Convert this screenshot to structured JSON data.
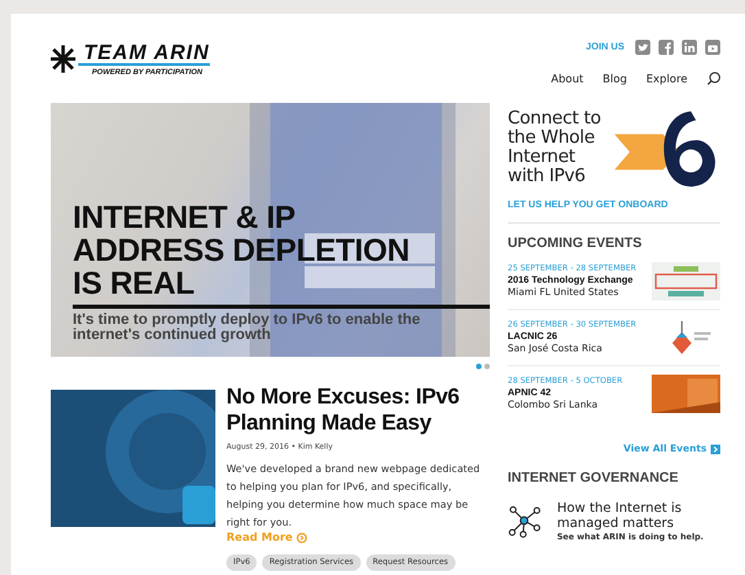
{
  "logo": {
    "name": "TEAM ARIN",
    "tagline": "POWERED BY PARTICIPATION"
  },
  "social": {
    "label": "JOIN US"
  },
  "nav": [
    {
      "label": "About"
    },
    {
      "label": "Blog"
    },
    {
      "label": "Explore"
    }
  ],
  "hero": {
    "headline": "INTERNET & IP ADDRESS DEPLETION IS REAL",
    "subtitle": "It's time to promptly deploy to IPv6 to enable the internet's continued growth",
    "slides": [
      {
        "selected": true
      },
      {
        "selected": false
      }
    ]
  },
  "post": {
    "title": "No More Excuses: IPv6 Planning Made Easy",
    "meta": "August 29, 2016 • Kim Kelly",
    "body": "We've developed a brand new webpage dedicated to helping you plan for IPv6, and specifically, helping you determine how much space may be right for you.",
    "read_more": "Read More",
    "tags": [
      "IPv6",
      "Registration Services",
      "Request Resources"
    ]
  },
  "promo": {
    "text": "Connect to the Whole Internet with IPv6",
    "link": "LET US HELP YOU GET ONBOARD"
  },
  "events": {
    "heading": "UPCOMING EVENTS",
    "items": [
      {
        "dates": "25 SEPTEMBER - 28 SEPTEMBER",
        "name": "2016 Technology Exchange",
        "place": "Miami FL United States",
        "kind": "techex"
      },
      {
        "dates": "26 SEPTEMBER - 30 SEPTEMBER",
        "name": "LACNIC 26",
        "place": "San José Costa Rica",
        "kind": "lacnic"
      },
      {
        "dates": "28 SEPTEMBER - 5 OCTOBER",
        "name": "APNIC 42",
        "place": "Colombo Sri Lanka",
        "kind": "apnic"
      }
    ],
    "view_all": "View All Events"
  },
  "governance": {
    "heading": "INTERNET GOVERNANCE",
    "title": "How the Internet is managed matters",
    "link": "See what ARIN is doing to help."
  }
}
